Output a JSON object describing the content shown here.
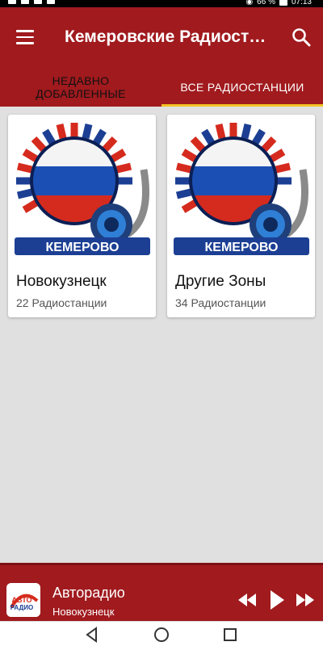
{
  "status_bar": {
    "battery": "66 %",
    "time": "07:13"
  },
  "app_bar": {
    "title": "Кемеровские Радиостанции",
    "menu_icon": "hamburger-menu-icon",
    "search_icon": "search-icon"
  },
  "tabs": [
    {
      "label": "НЕДАВНО\nДОБАВЛЕННЫЕ",
      "active": false
    },
    {
      "label": "ВСЕ РАДИОСТАНЦИИ",
      "active": true
    }
  ],
  "cards": [
    {
      "title": "Новокузнецк",
      "subtitle": "22 Радиостанции",
      "badge": "КЕМЕРОВО"
    },
    {
      "title": "Другие Зоны",
      "subtitle": "34 Радиостанции",
      "badge": "КЕМЕРОВО"
    }
  ],
  "player": {
    "station": "Авторадио",
    "location": "Новокузнецк",
    "logo_line1": "АВТО",
    "logo_line2": "РАДИО"
  },
  "colors": {
    "primary": "#a01a1e",
    "tab_indicator": "#f2c220",
    "background": "#e0e0e0"
  }
}
